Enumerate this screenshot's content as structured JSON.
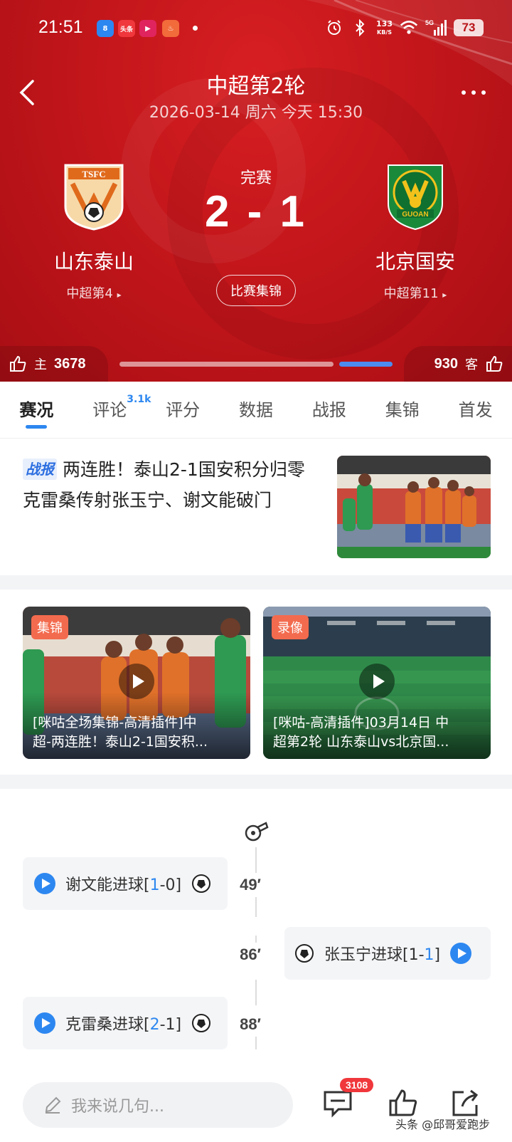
{
  "status_bar": {
    "time": "21:51",
    "net_speed_value": "133",
    "net_speed_unit": "KB/S",
    "network": "5G",
    "battery": "73",
    "app_icons": [
      {
        "label": "8",
        "color": "#2d87f0"
      },
      {
        "label": "头条",
        "color": "#f0373b"
      },
      {
        "label": "▶",
        "color": "#e0245e"
      },
      {
        "label": "♨",
        "color": "#f26b3a"
      }
    ]
  },
  "header": {
    "title": "中超第2轮",
    "date": "2026-03-14 周六 今天 15:30"
  },
  "match": {
    "status": "完赛",
    "score": "2 - 1",
    "highlights_label": "比赛集锦",
    "home": {
      "name": "山东泰山",
      "rank": "中超第4",
      "logo_text": "TSFC"
    },
    "away": {
      "name": "北京国安",
      "rank": "中超第11",
      "logo_text": "GUOAN"
    }
  },
  "votes": {
    "home_label": "主",
    "home_count": "3678",
    "away_label": "客",
    "away_count": "930",
    "home_fraction": 0.8,
    "away_fraction": 0.2
  },
  "tabs": [
    {
      "label": "赛况",
      "active": true
    },
    {
      "label": "评论",
      "badge": "3.1k"
    },
    {
      "label": "评分"
    },
    {
      "label": "数据"
    },
    {
      "label": "战报"
    },
    {
      "label": "集锦"
    },
    {
      "label": "首发"
    }
  ],
  "news": {
    "tag": "战报",
    "title": "两连胜！泰山2-1国安积分归零 克雷桑传射张玉宁、谢文能破门"
  },
  "videos": [
    {
      "tag": "集锦",
      "title_line1": "[咪咕全场集锦-高清插件]中",
      "title_line2": "超-两连胜！泰山2-1国安积..."
    },
    {
      "tag": "录像",
      "title_line1": "[咪咕-高清插件]03月14日 中",
      "title_line2": "超第2轮 山东泰山vs北京国..."
    }
  ],
  "timeline": {
    "events": [
      {
        "side": "left",
        "player_text": "谢文能进球[",
        "s1": "1",
        "dash": "-",
        "s2": "0",
        "close": "]",
        "minute": "49′",
        "hi": "s1"
      },
      {
        "side": "right",
        "player_text": "张玉宁进球[",
        "s1": "1",
        "dash": "-",
        "s2": "1",
        "close": "]",
        "minute": "86′",
        "hi": "s2"
      },
      {
        "side": "left",
        "player_text": "克雷桑进球[",
        "s1": "2",
        "dash": "-",
        "s2": "1",
        "close": "]",
        "minute": "88′",
        "hi": "s1"
      }
    ]
  },
  "bottom_bar": {
    "comment_placeholder": "我来说几句...",
    "comment_count": "3108",
    "watermark": "头条 @邱哥爱跑步"
  },
  "colors": {
    "hero_red": "#c3161b",
    "accent_blue": "#2d87f0",
    "tag_orange": "#f36b4e",
    "badge_red": "#f0373b"
  }
}
